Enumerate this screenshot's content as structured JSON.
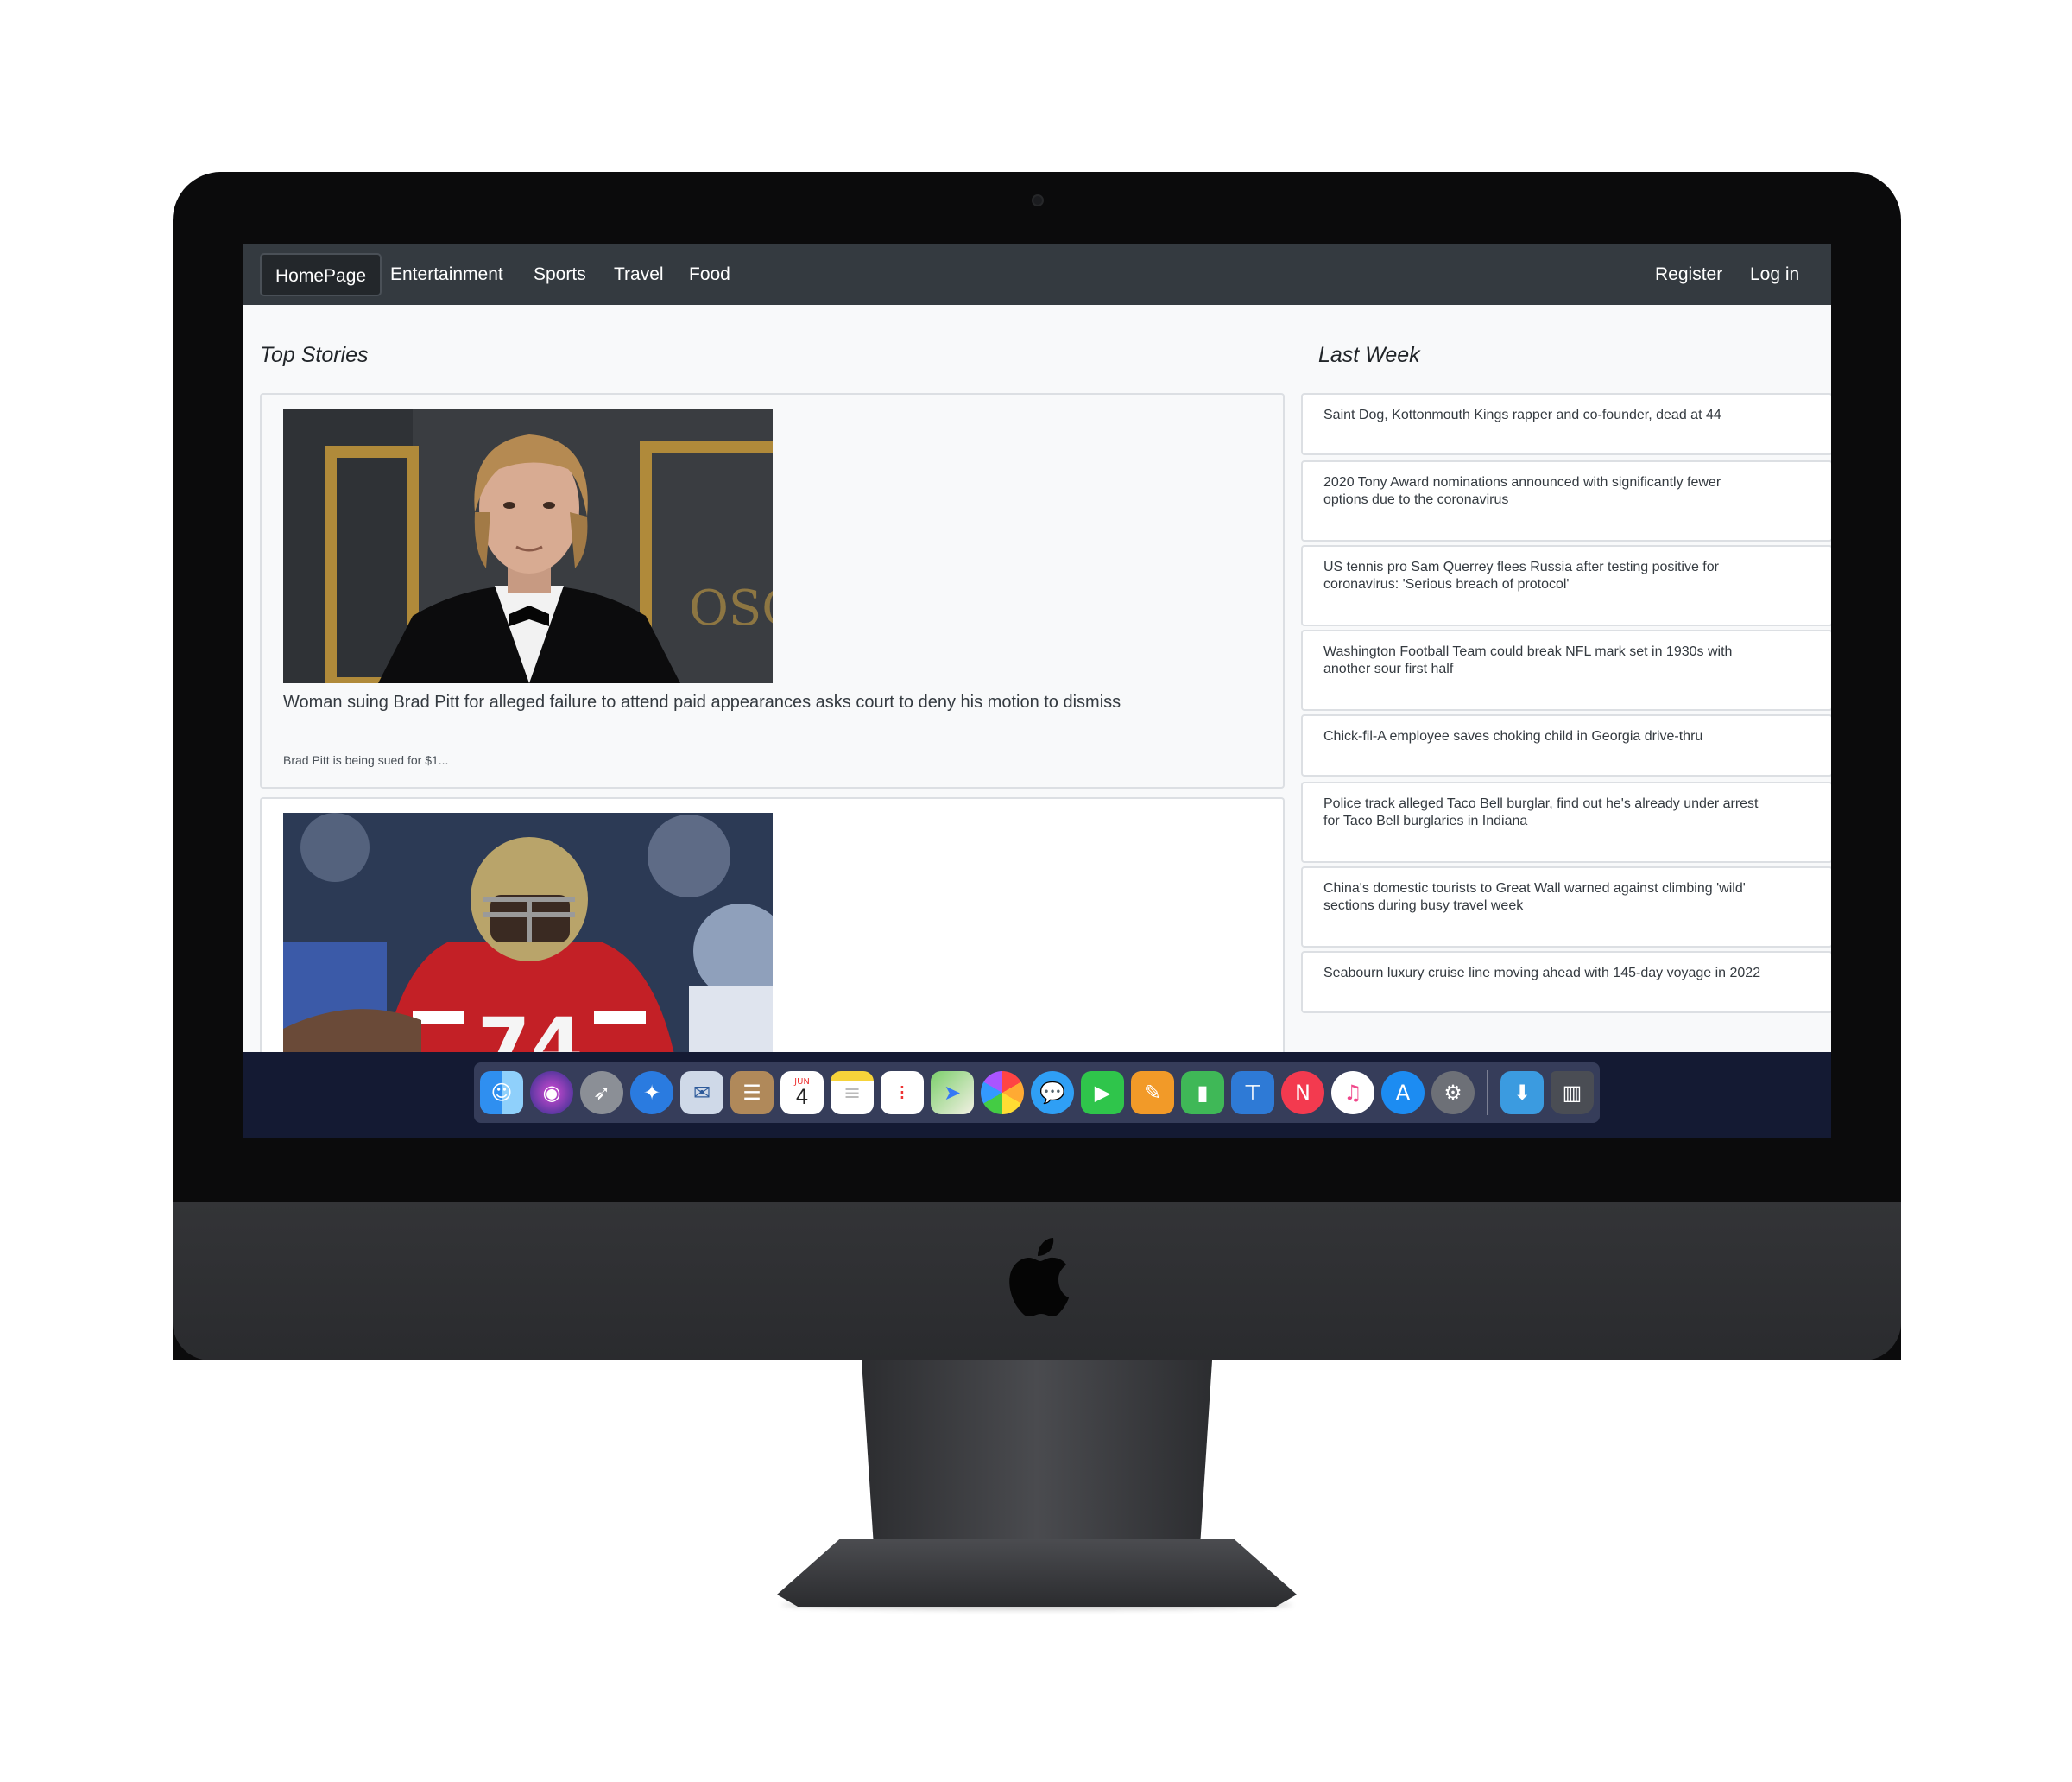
{
  "navbar": {
    "left_items": [
      "HomePage",
      "Entertainment",
      "Sports",
      "Travel",
      "Food"
    ],
    "active": "HomePage",
    "right_items": [
      "Register",
      "Log in"
    ]
  },
  "top_stories": {
    "title": "Top Stories",
    "stories": [
      {
        "image": "brad-pitt-photo",
        "headline": "Woman suing Brad Pitt for alleged failure to attend paid appearances asks court to deny his motion to dismiss",
        "summary": "Brad Pitt is being sued for $1..."
      },
      {
        "image": "football-player-photo",
        "headline": "",
        "summary": ""
      }
    ]
  },
  "last_week": {
    "title": "Last Week",
    "items": [
      {
        "line1": "Saint Dog, Kottonmouth Kings rapper and co-founder, dead at 44",
        "line2": ""
      },
      {
        "line1": "2020 Tony Award nominations announced with significantly fewer",
        "line2": "options due to the coronavirus"
      },
      {
        "line1": "US tennis pro Sam Querrey flees Russia after testing positive for",
        "line2": "coronavirus: 'Serious breach of protocol'"
      },
      {
        "line1": "Washington Football Team could break NFL mark set in 1930s with",
        "line2": "another sour first half"
      },
      {
        "line1": "Chick-fil-A employee saves choking child in Georgia drive-thru",
        "line2": ""
      },
      {
        "line1": "Police track alleged Taco Bell burglar, find out he's already under arrest",
        "line2": "for Taco Bell burglaries in Indiana"
      },
      {
        "line1": "China's domestic tourists to Great Wall warned against climbing 'wild'",
        "line2": "sections during busy travel week"
      },
      {
        "line1": "Seabourn luxury cruise line moving ahead with 145-day voyage in 2022",
        "line2": ""
      }
    ]
  },
  "dock": {
    "calendar_month": "JUN",
    "calendar_day": "4",
    "apps": [
      "finder-icon",
      "siri-icon",
      "launchpad-icon",
      "safari-icon",
      "mail-icon",
      "contacts-icon",
      "calendar-icon",
      "notes-icon",
      "reminders-icon",
      "maps-icon",
      "photos-icon",
      "messages-icon",
      "facetime-icon",
      "pages-icon",
      "numbers-icon",
      "keynote-icon",
      "news-icon",
      "itunes-icon",
      "app-store-icon",
      "system-preferences-icon",
      "downloads-folder-icon",
      "trash-icon"
    ]
  },
  "colors": {
    "navbar_bg": "#343a40",
    "content_bg": "#f8f9fa",
    "dock_band": "#141a33"
  }
}
